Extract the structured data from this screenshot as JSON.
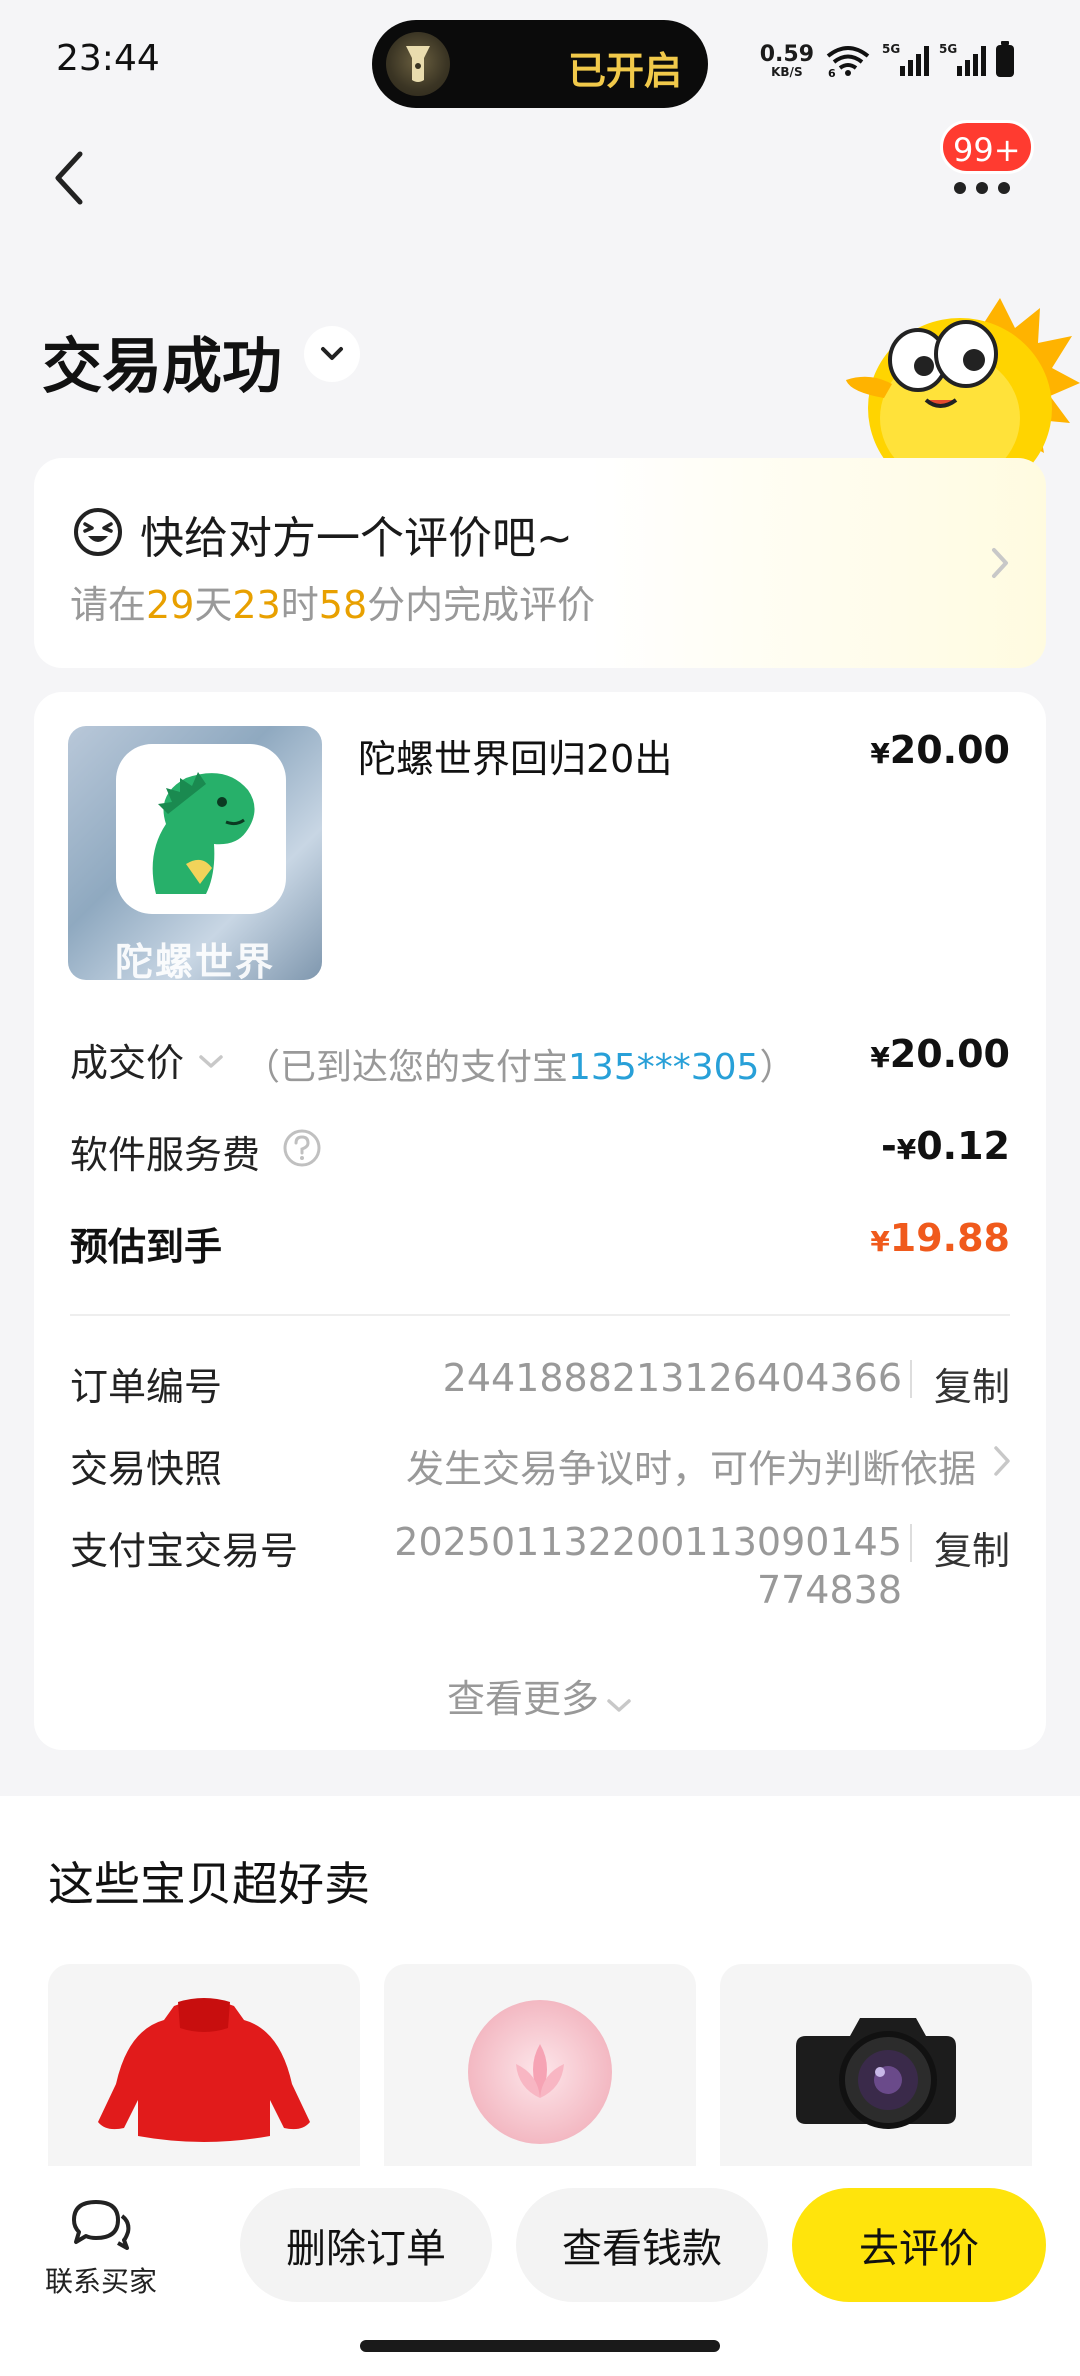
{
  "status_bar": {
    "time": "23:44",
    "island_text": "已开启",
    "net_speed": "0.59",
    "net_unit": "KB/S",
    "wifi_tag": "6",
    "signal_tag_1": "5G",
    "signal_tag_2": "5G"
  },
  "nav": {
    "badge": "99+"
  },
  "header": {
    "title": "交易成功"
  },
  "review": {
    "title": "快给对方一个评价吧~",
    "prefix": "请在",
    "days": "29",
    "days_unit": "天",
    "hours": "23",
    "hours_unit": "时",
    "minutes": "58",
    "suffix": "分内完成评价"
  },
  "order": {
    "thumb_label": "陀螺世界",
    "item_title": "陀螺世界回归20出",
    "currency": "¥",
    "item_price": "20.00",
    "deal_label": "成交价",
    "deal_note_prefix": "（已到达您的支付宝",
    "deal_note_account": "135***305",
    "deal_note_suffix": "）",
    "deal_value": "20.00",
    "fee_label": "软件服务费",
    "fee_sign": "-",
    "fee_value": "0.12",
    "total_label": "预估到手",
    "total_value": "19.88",
    "order_no_label": "订单编号",
    "order_no": "2441888213126404366",
    "copy": "复制",
    "snapshot_label": "交易快照",
    "snapshot_value": "发生交易争议时，可作为判断依据",
    "alipay_label": "支付宝交易号",
    "alipay_no_line1": "202501132200113090145",
    "alipay_no_line1_display": "202501132200113090145",
    "alipay_no_line2": "774838",
    "see_more": "查看更多"
  },
  "recommend": {
    "title": "这些宝贝超好卖"
  },
  "bottom_bar": {
    "contact_label": "联系买家",
    "delete_order": "删除订单",
    "view_payment": "查看钱款",
    "review": "去评价"
  },
  "colors": {
    "accent_yellow": "#ffe40c",
    "highlight_orange": "#e8a000",
    "price_red": "#f05a1c",
    "link_blue": "#28a0d8",
    "badge_red": "#ff3b30"
  },
  "icons": [
    "flashlight-icon",
    "wifi-icon",
    "signal-icon",
    "battery-icon",
    "back-arrow-icon",
    "more-icon",
    "chevron-down-icon",
    "mascot-icon",
    "laughing-face-icon",
    "chevron-right-icon",
    "question-icon",
    "chat-icon"
  ]
}
